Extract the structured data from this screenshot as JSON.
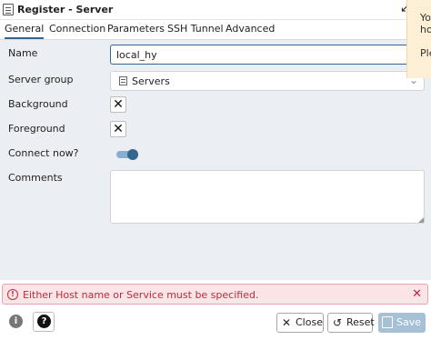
{
  "window": {
    "title": "Register - Server",
    "title_icon": "server-icon",
    "corner_icon": "collapse-arrow-icon",
    "corner_glyph": "↙"
  },
  "tabs": [
    {
      "label": "General",
      "active": true
    },
    {
      "label": "Connection",
      "active": false
    },
    {
      "label": "Parameters",
      "active": false
    },
    {
      "label": "SSH Tunnel",
      "active": false
    },
    {
      "label": "Advanced",
      "active": false
    }
  ],
  "form": {
    "name": {
      "label": "Name",
      "value": "local_hy"
    },
    "server_group": {
      "label": "Server group",
      "value": "Servers",
      "icon": "server-group-icon"
    },
    "background": {
      "label": "Background",
      "value_glyph": "✕"
    },
    "foreground": {
      "label": "Foreground",
      "value_glyph": "✕"
    },
    "connect_now": {
      "label": "Connect now?",
      "on": true
    },
    "comments": {
      "label": "Comments",
      "value": ""
    }
  },
  "error": {
    "message": "Either Host name or Service must be specified.",
    "icon_glyph": "!",
    "close_glyph": "✕"
  },
  "footer": {
    "info_glyph": "i",
    "help_glyph": "?",
    "close_label": "Close",
    "reset_label": "Reset",
    "save_label": "Save"
  },
  "notification": {
    "lines": [
      "Yo",
      "ho",
      "Ple"
    ]
  },
  "colors": {
    "accent": "#326690",
    "error": "#c6283d",
    "form_bg": "#ebeef3"
  }
}
